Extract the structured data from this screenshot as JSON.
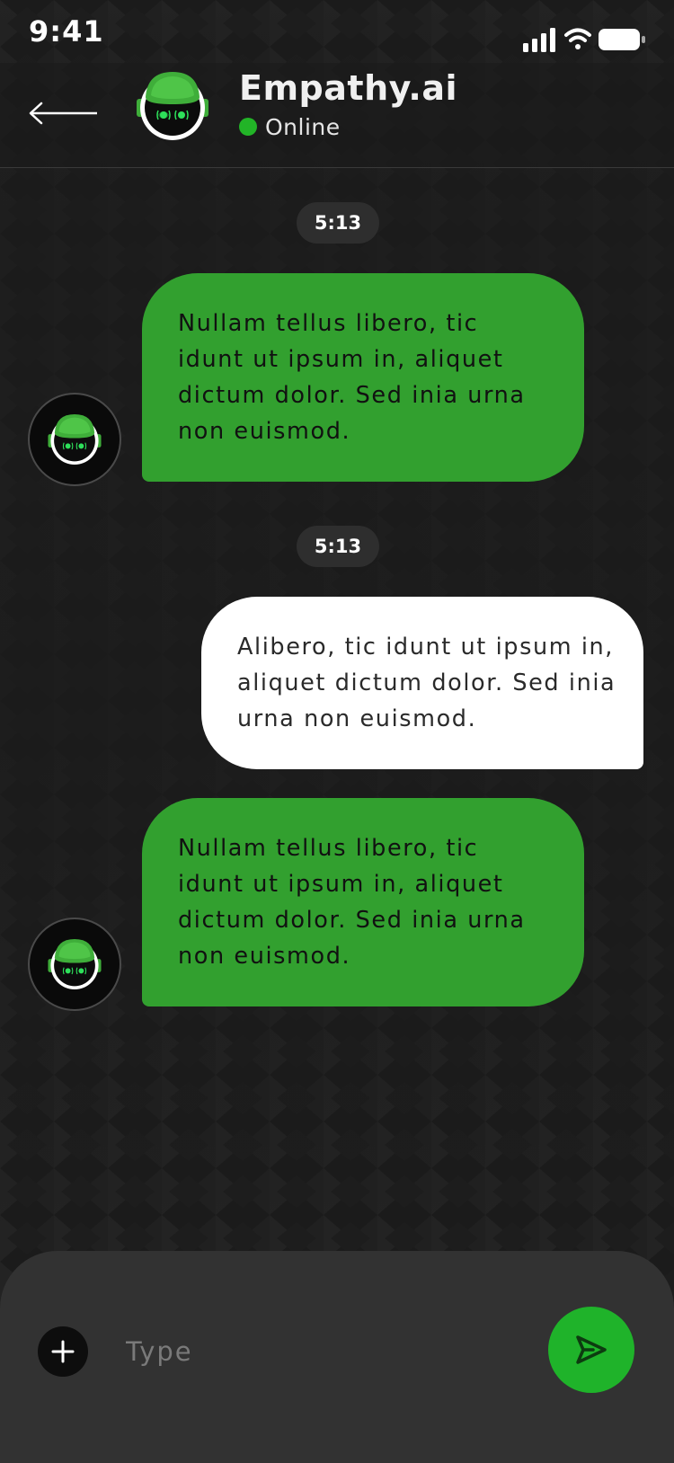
{
  "status_bar": {
    "time": "9:41",
    "icons": [
      "cellular-signal-icon",
      "wifi-icon",
      "battery-icon"
    ]
  },
  "header": {
    "back_icon": "arrow-left-icon",
    "avatar_icon": "robot-icon",
    "title": "Empathy.ai",
    "status": "Online"
  },
  "chat": {
    "messages": [
      {
        "kind": "time",
        "text": "5:13"
      },
      {
        "kind": "bot",
        "text": "Nullam tellus libero, tic idunt ut ipsum in, aliquet dictum dolor. Sed inia urna non euismod."
      },
      {
        "kind": "time",
        "text": "5:13"
      },
      {
        "kind": "user",
        "text": "Alibero, tic idunt ut ipsum in, aliquet dictum dolor. Sed inia urna non euismod."
      },
      {
        "kind": "bot",
        "text": "Nullam tellus libero, tic idunt ut ipsum in, aliquet dictum dolor. Sed inia urna non euismod."
      }
    ]
  },
  "composer": {
    "attach_icon": "plus-icon",
    "placeholder": "Type",
    "value": "",
    "send_icon": "send-icon"
  },
  "colors": {
    "background": "#1b1b1b",
    "bot_bubble": "#32a02f",
    "user_bubble": "#ffffff",
    "accent": "#1fb32a",
    "online": "#22b427",
    "composer": "#323232",
    "time_chip": "#2e2e2e"
  }
}
